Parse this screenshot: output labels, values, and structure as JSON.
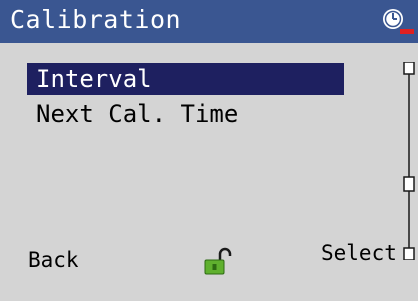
{
  "screen": {
    "title": "Calibration"
  },
  "menu": {
    "items": [
      {
        "label": "Interval",
        "selected": true
      },
      {
        "label": "Next Cal. Time",
        "selected": false
      }
    ]
  },
  "softkeys": {
    "left": "Back",
    "right": "Select"
  },
  "icons": {
    "status": "clock-alarm-icon",
    "lock": "unlocked-padlock-icon"
  },
  "colors": {
    "titlebar": "#3a5691",
    "selection": "#1e2060",
    "background": "#d4d4d4",
    "lock": "#5fb02e",
    "alert": "#e02020"
  }
}
